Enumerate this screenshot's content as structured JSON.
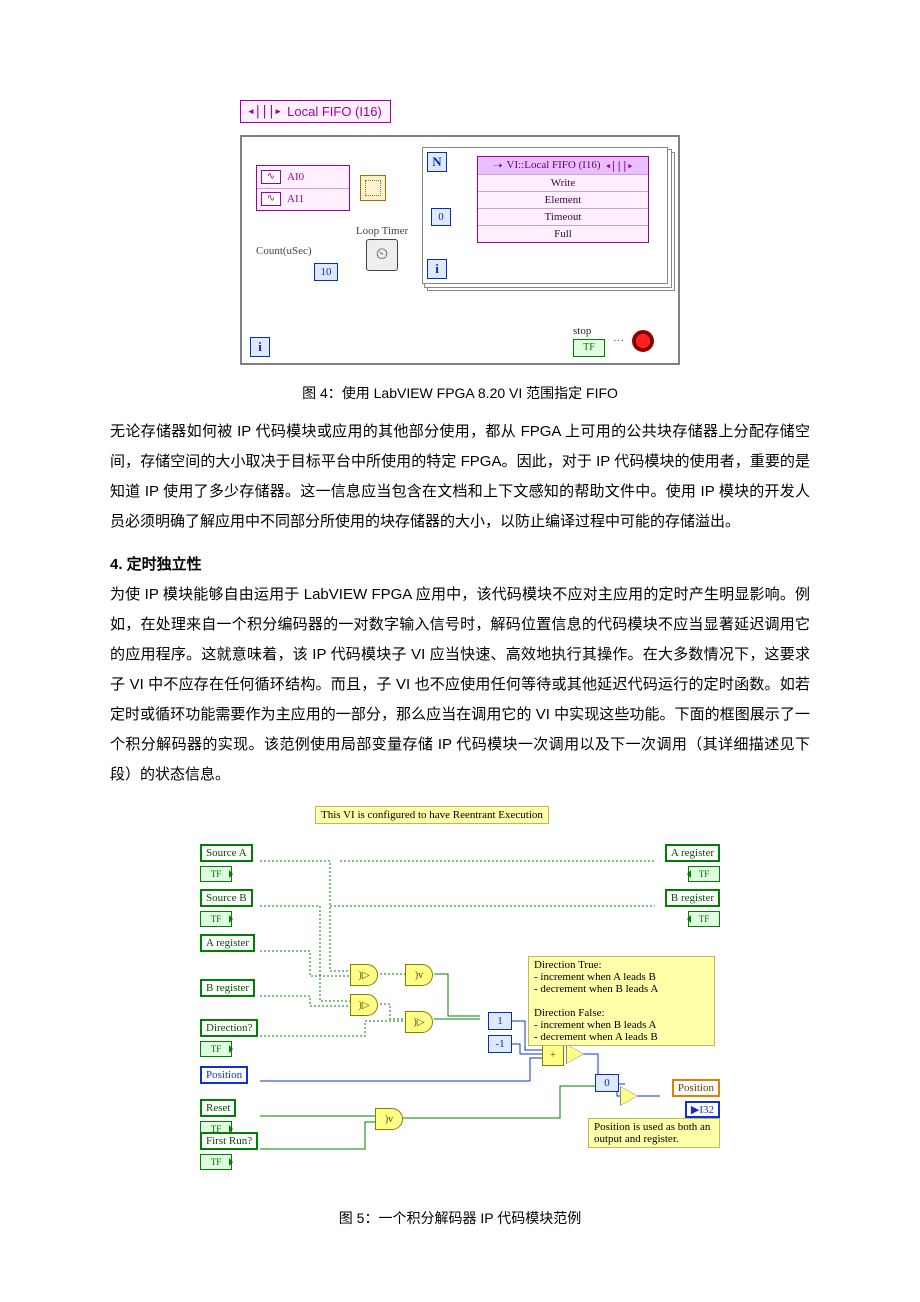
{
  "fig4": {
    "local_fifo_label": "Local FIFO (I16)",
    "ai0": "AI0",
    "ai1": "AI1",
    "count_label": "Count(uSec)",
    "ten": "10",
    "loop_timer": "Loop Timer",
    "N": "N",
    "zero": "0",
    "i_low": "i",
    "i_for": "i",
    "vi_fifo_header": "VI::Local FIFO (I16)",
    "row_write": "Write",
    "row_element": "Element",
    "row_timeout": "Timeout",
    "row_full": "Full",
    "stop_label": "stop",
    "tf": "TF"
  },
  "fig4_caption": "图 4：使用 LabVIEW FPGA 8.20 VI 范围指定 FIFO",
  "para1": "无论存储器如何被 IP 代码模块或应用的其他部分使用，都从 FPGA 上可用的公共块存储器上分配存储空间，存储空间的大小取决于目标平台中所使用的特定 FPGA。因此，对于 IP 代码模块的使用者，重要的是知道 IP 使用了多少存储器。这一信息应当包含在文档和上下文感知的帮助文件中。使用 IP 模块的开发人员必须明确了解应用中不同部分所使用的块存储器的大小，以防止编译过程中可能的存储溢出。",
  "h4": "4. 定时独立性",
  "para2": "为使 IP 模块能够自由运用于 LabVIEW FPGA 应用中，该代码模块不应对主应用的定时产生明显影响。例如，在处理来自一个积分编码器的一对数字输入信号时，解码位置信息的代码模块不应当显著延迟调用它的应用程序。这就意味着，该 IP 代码模块子 VI 应当快速、高效地执行其操作。在大多数情况下，这要求子 VI 中不应存在任何循环结构。而且，子 VI 也不应使用任何等待或其他延迟代码运行的定时函数。如若定时或循环功能需要作为主应用的一部分，那么应当在调用它的 VI 中实现这些功能。下面的框图展示了一个积分解码器的实现。该范例使用局部变量存储 IP 代码模块一次调用以及下一次调用（其详细描述见下段）的状态信息。",
  "fig5": {
    "note_top": "This VI is configured to have Reentrant Execution",
    "source_a": "Source A",
    "source_b": "Source B",
    "a_reg": "A register",
    "b_reg": "B register",
    "direction": "Direction?",
    "position": "Position",
    "reset": "Reset",
    "first_run": "First Run?",
    "tf": "TF",
    "i32": "I32",
    "const_1": "1",
    "const_n1": "-1",
    "const_0": "0",
    "note_dir": "Direction True:\n- increment when A leads B\n- decrement when B leads A\n\nDirection False:\n- increment when B leads A\n- decrement when A leads B",
    "note_pos": "Position is used as both an output and register."
  },
  "fig5_caption": "图 5：一个积分解码器 IP 代码模块范例"
}
